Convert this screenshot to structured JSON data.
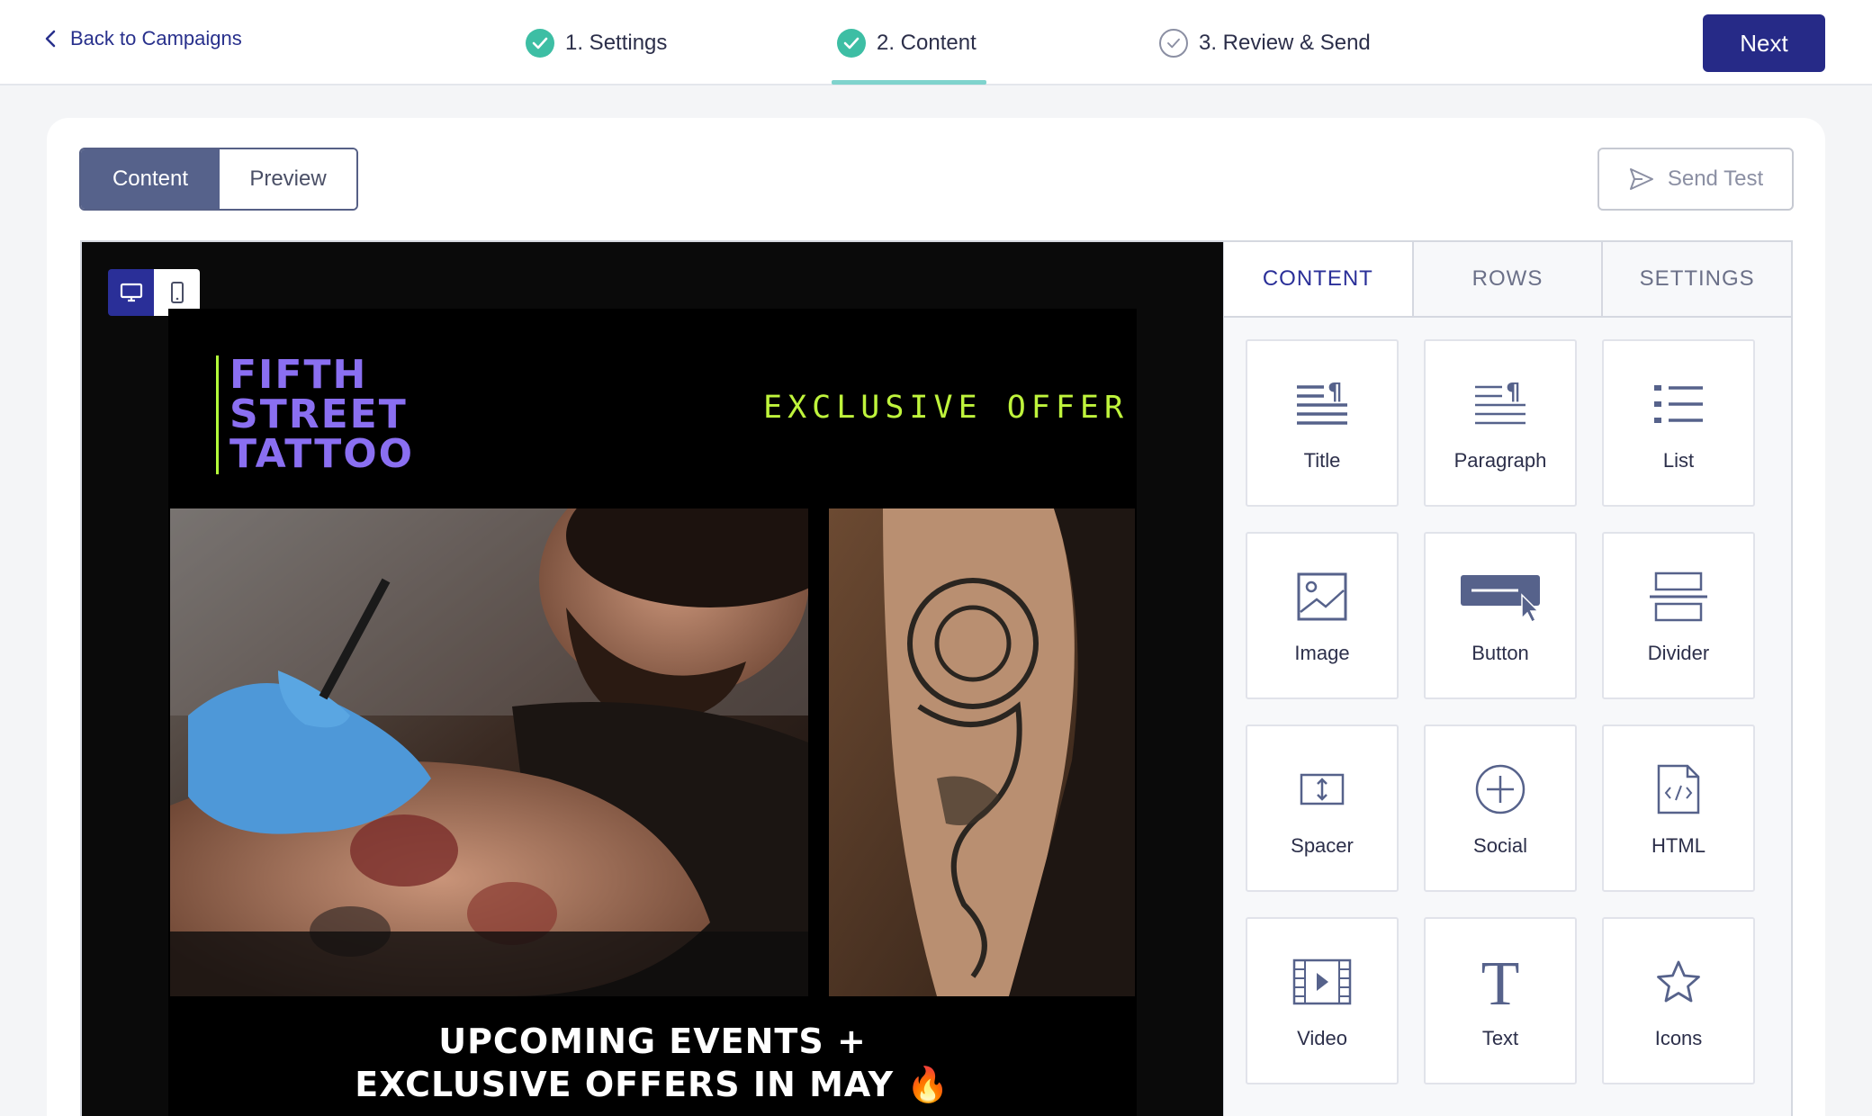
{
  "topbar": {
    "back_label": "Back to Campaigns",
    "steps": [
      {
        "label": "1. Settings",
        "status": "done"
      },
      {
        "label": "2. Content",
        "status": "done"
      },
      {
        "label": "3. Review & Send",
        "status": "todo"
      }
    ],
    "next_label": "Next"
  },
  "editor": {
    "mode_tabs": [
      "Content",
      "Preview"
    ],
    "send_test_label": "Send Test",
    "device_toggle": [
      "desktop-icon",
      "mobile-icon"
    ]
  },
  "email": {
    "brand_lines": [
      "FIFTH",
      "STREET",
      "TATTOO"
    ],
    "offer_text": "EXCLUSIVE OFFER",
    "headline_line1": "UPCOMING EVENTS +",
    "headline_line2": "EXCLUSIVE OFFERS IN MAY",
    "headline_emoji": "🔥"
  },
  "side_panel": {
    "tabs": [
      "CONTENT",
      "ROWS",
      "SETTINGS"
    ],
    "blocks": [
      {
        "label": "Title",
        "icon": "title-icon"
      },
      {
        "label": "Paragraph",
        "icon": "paragraph-icon"
      },
      {
        "label": "List",
        "icon": "list-icon"
      },
      {
        "label": "Image",
        "icon": "image-icon"
      },
      {
        "label": "Button",
        "icon": "button-icon"
      },
      {
        "label": "Divider",
        "icon": "divider-icon"
      },
      {
        "label": "Spacer",
        "icon": "spacer-icon"
      },
      {
        "label": "Social",
        "icon": "social-icon"
      },
      {
        "label": "HTML",
        "icon": "html-icon"
      },
      {
        "label": "Video",
        "icon": "video-icon"
      },
      {
        "label": "Text",
        "icon": "text-icon"
      },
      {
        "label": "Icons",
        "icon": "star-icon"
      }
    ]
  },
  "colors": {
    "primary": "#262a87",
    "success": "#3dbea4",
    "brand_purple": "#8a6ff1",
    "brand_lime": "#bff43c"
  }
}
